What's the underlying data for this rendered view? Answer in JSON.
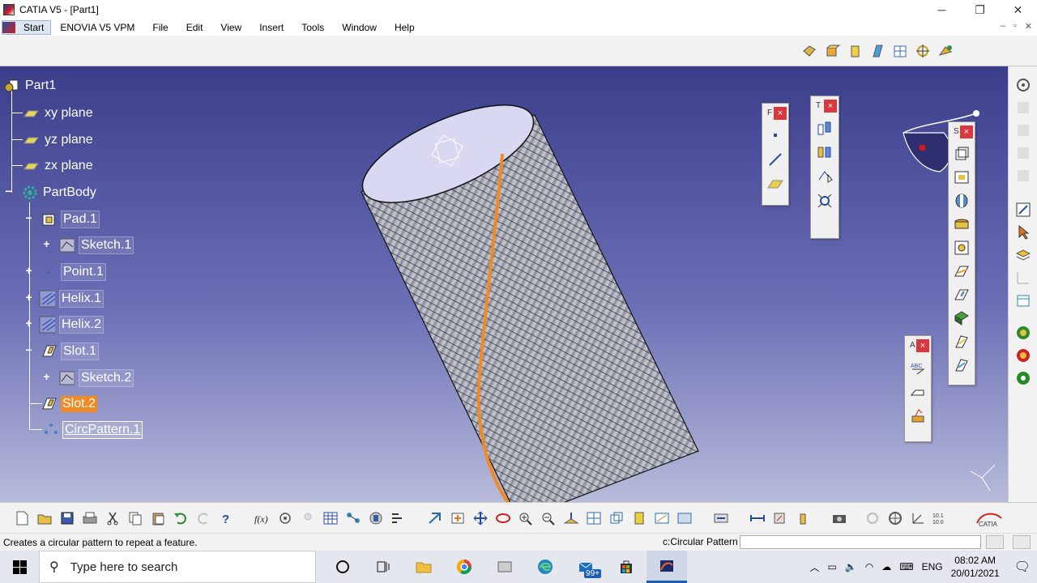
{
  "window": {
    "title": "CATIA V5 - [Part1]",
    "minimize": "─",
    "restore": "❐",
    "close": "✕"
  },
  "menu": {
    "start": "Start",
    "items": [
      "ENOVIA V5 VPM",
      "File",
      "Edit",
      "View",
      "Insert",
      "Tools",
      "Window",
      "Help"
    ],
    "mdi": [
      "–",
      "▫",
      "✕"
    ]
  },
  "tree": {
    "root": "Part1",
    "xy": "xy plane",
    "yz": "yz plane",
    "zx": "zx plane",
    "body": "PartBody",
    "pad": "Pad.1",
    "sketch1": "Sketch.1",
    "point": "Point.1",
    "helix1": "Helix.1",
    "helix2": "Helix.2",
    "slot1": "Slot.1",
    "sketch2": "Sketch.2",
    "slot2": "Slot.2",
    "pattern": "CircPattern.1"
  },
  "panels": {
    "p1": {
      "head": "F"
    },
    "p2": {
      "head": "T"
    },
    "p3": {
      "head": "S"
    },
    "p4": {
      "head": "A"
    },
    "close": "×"
  },
  "status": {
    "message": "Creates a circular pattern to repeat a feature.",
    "command_label": "c:Circular Pattern",
    "command_value": ""
  },
  "taskbar": {
    "search_placeholder": "Type here to search",
    "mail_badge": "99+",
    "lang": "ENG",
    "time": "08:02 AM",
    "date": "20/01/2021"
  },
  "colors": {
    "viewport_top": "#3b3e8a",
    "viewport_bottom": "#b8bbd9",
    "selection": "#f08a24",
    "panel_close": "#d9393c"
  }
}
